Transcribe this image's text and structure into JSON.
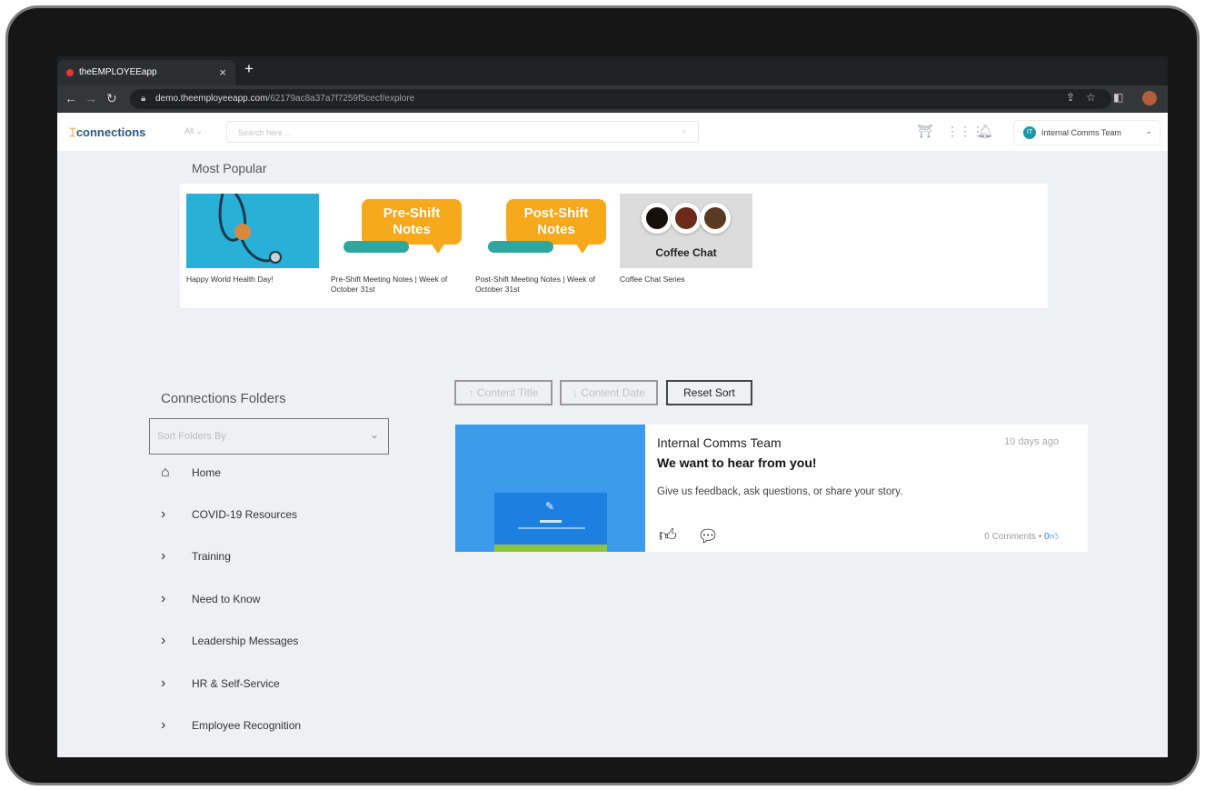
{
  "browser": {
    "tab_title": "theEMPLOYEEapp",
    "tab_close": "×",
    "new_tab": "+",
    "url_domain": "demo.theemployeeapp.com",
    "url_path": "/62179ac8a37a7f7259f5cecf/explore"
  },
  "header": {
    "logo": "connections",
    "scope": "All",
    "search_placeholder": "Search here ...",
    "team_initials": "IT",
    "team_name": "Internal Comms Team"
  },
  "most_popular": {
    "title": "Most Popular",
    "items": [
      {
        "caption": "Happy World Health Day!"
      },
      {
        "caption": "Pre-Shift Meeting Notes | Week of October 31st",
        "thumb_text_1": "Pre-Shift",
        "thumb_text_2": "Notes"
      },
      {
        "caption": "Post-Shift Meeting Notes | Week of October 31st",
        "thumb_text_1": "Post-Shift",
        "thumb_text_2": "Notes"
      },
      {
        "caption": "Coffee Chat Series",
        "thumb_text": "Coffee Chat"
      }
    ]
  },
  "folders": {
    "title": "Connections Folders",
    "sort_placeholder": "Sort Folders By",
    "items": [
      {
        "label": "Home"
      },
      {
        "label": "COVID-19 Resources"
      },
      {
        "label": "Training"
      },
      {
        "label": "Need to Know"
      },
      {
        "label": "Leadership Messages"
      },
      {
        "label": "HR & Self-Service"
      },
      {
        "label": "Employee Recognition"
      }
    ]
  },
  "sort": {
    "title_label": "Content Title",
    "date_label": "Content Date",
    "reset_label": "Reset Sort"
  },
  "post": {
    "author": "Internal Comms Team",
    "time": "10 days ago",
    "title": "We want to hear from you!",
    "body": "Give us feedback, ask questions, or share your story.",
    "comments": "0 Comments",
    "likes": "0"
  }
}
